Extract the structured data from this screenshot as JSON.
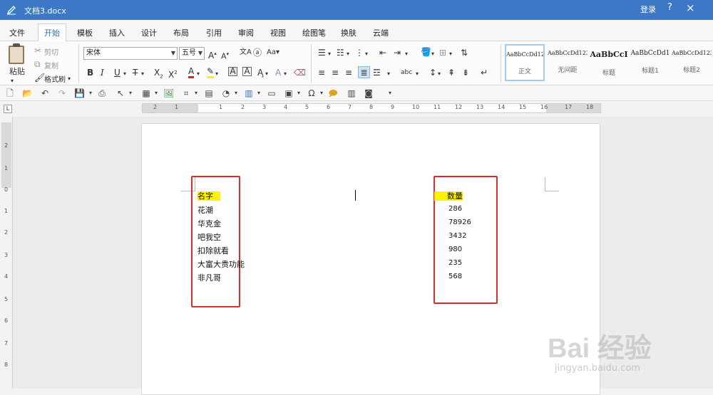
{
  "titlebar": {
    "title": "文档3.docx",
    "login": "登录",
    "help": "?",
    "close": "×"
  },
  "menu": [
    "文件",
    "开始",
    "模板",
    "插入",
    "设计",
    "布局",
    "引用",
    "审阅",
    "视图",
    "绘图笔",
    "换肤",
    "云端"
  ],
  "ribbon": {
    "clipboard": {
      "paste": "粘贴",
      "cut": "剪切",
      "copy": "复制",
      "format_painter": "格式刷"
    },
    "font": {
      "name": "宋体",
      "size": "五号"
    },
    "styles": [
      {
        "sample": "AaBbCcDd123",
        "name": "正文"
      },
      {
        "sample": "AaBbCcDd123",
        "name": "无间距"
      },
      {
        "sample": "AaBbCcI",
        "name": "标题"
      },
      {
        "sample": "AaBbCcDd1",
        "name": "标题1"
      },
      {
        "sample": "AaBbCcDd123",
        "name": "标题2"
      }
    ]
  },
  "rulers": {
    "h_numbers": [
      "2",
      "1",
      "1",
      "2",
      "3",
      "4",
      "5",
      "6",
      "7",
      "8",
      "9",
      "10",
      "11",
      "12",
      "13",
      "14",
      "15",
      "16",
      "17",
      "18"
    ],
    "v_numbers": [
      "2",
      "1",
      "0",
      "1",
      "2",
      "3",
      "4",
      "5",
      "6",
      "7",
      "8"
    ],
    "corner": "L"
  },
  "document": {
    "col1_header": "名字",
    "col1_items": [
      "花潮",
      "华克金",
      "吧我空",
      "扣除就看",
      "大富大贵功能",
      "非凡哥"
    ],
    "col2_header": "数量",
    "col2_items": [
      "286",
      "78926",
      "3432",
      "980",
      "235",
      "568"
    ]
  },
  "watermark": {
    "brand": "Bai 经验",
    "url": "jingyan.baidu.com"
  },
  "colors": {
    "titlebar": "#3c78c6",
    "highlight": "#fff200",
    "red_box": "#d42e2e"
  }
}
